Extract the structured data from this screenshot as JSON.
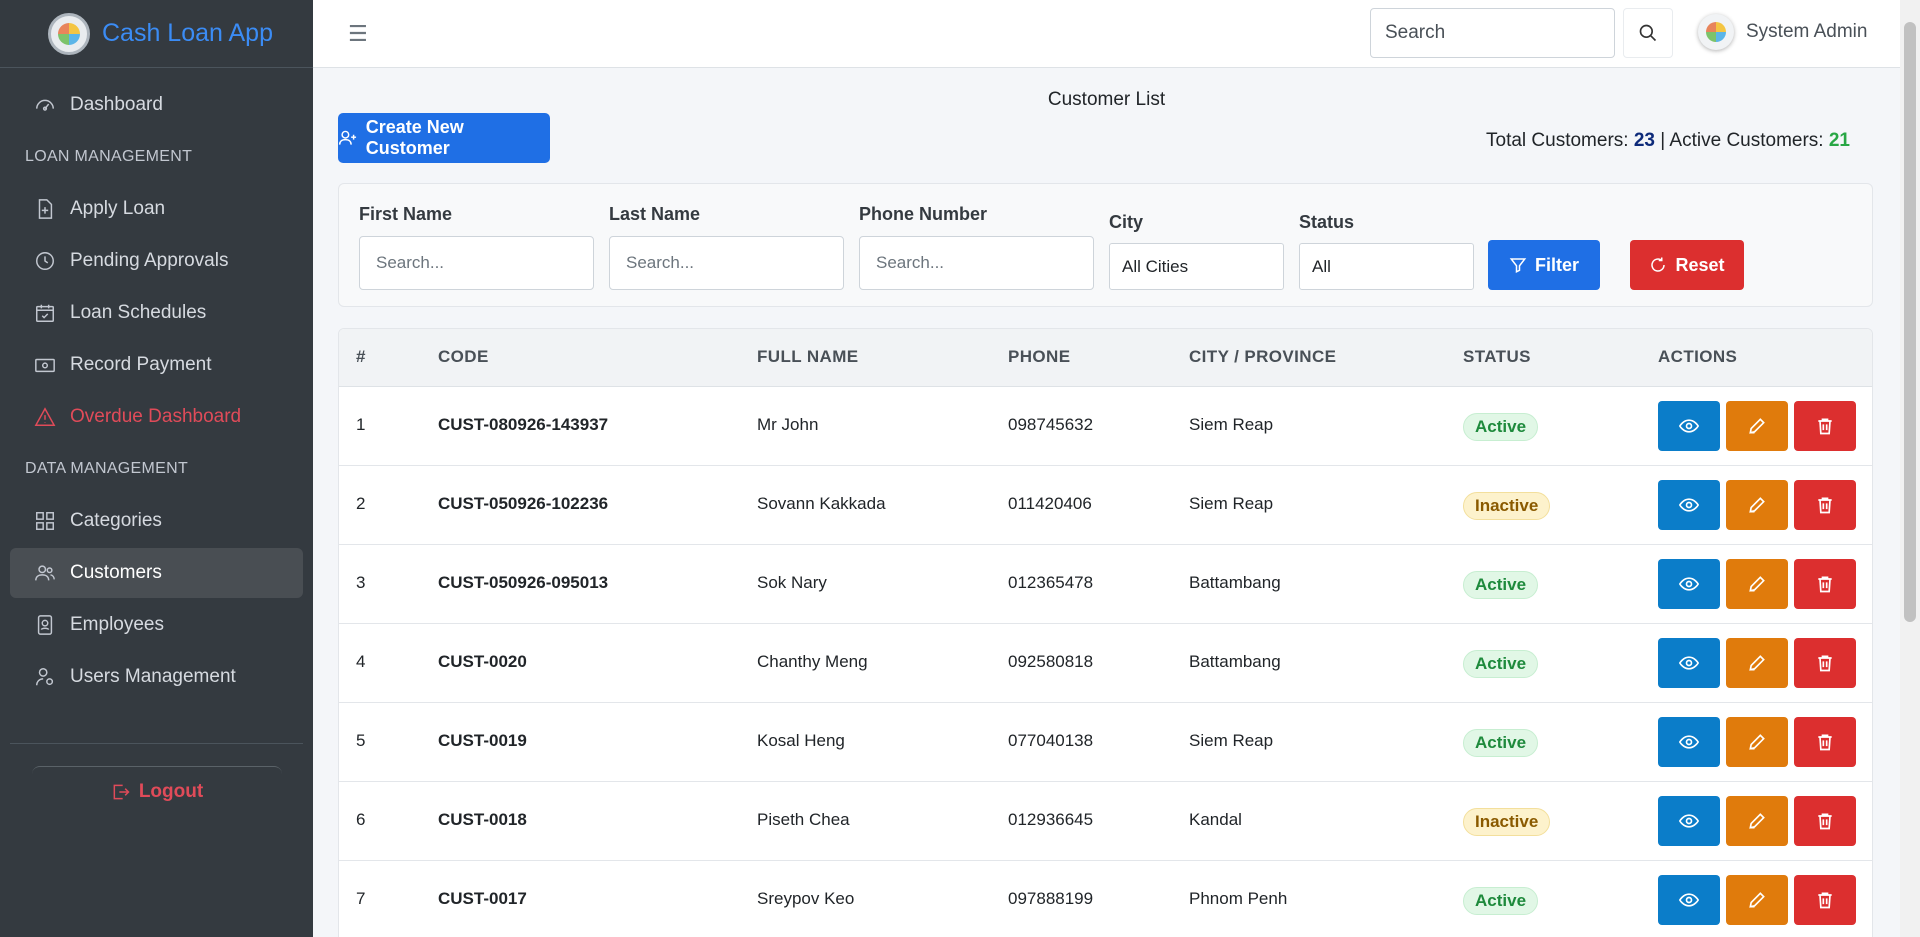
{
  "brand": {
    "name": "Cash Loan App"
  },
  "sidebar": {
    "items": [
      {
        "label": "Dashboard",
        "icon": "gauge-icon"
      },
      {
        "header": "LOAN MANAGEMENT"
      },
      {
        "label": "Apply Loan",
        "icon": "file-plus-icon"
      },
      {
        "label": "Pending Approvals",
        "icon": "clock-icon"
      },
      {
        "label": "Loan Schedules",
        "icon": "calendar-check-icon"
      },
      {
        "label": "Record Payment",
        "icon": "cash-icon"
      },
      {
        "label": "Overdue Dashboard",
        "icon": "warning-icon"
      },
      {
        "header": "DATA MANAGEMENT"
      },
      {
        "label": "Categories",
        "icon": "grid-icon"
      },
      {
        "label": "Customers",
        "icon": "users-icon"
      },
      {
        "label": "Employees",
        "icon": "badge-icon"
      },
      {
        "label": "Users Management",
        "icon": "user-gear-icon"
      }
    ],
    "logout": "Logout"
  },
  "topbar": {
    "search_placeholder": "Search",
    "user_name": "System Admin"
  },
  "page": {
    "title": "Customer List",
    "create_label": "Create New Customer",
    "totals": {
      "total_label": "Total Customers:",
      "total": "23",
      "sep": "|",
      "active_label": "Active Customers:",
      "active": "21"
    }
  },
  "filters": {
    "first_name_label": "First Name",
    "first_name_placeholder": "Search...",
    "last_name_label": "Last Name",
    "last_name_placeholder": "Search...",
    "phone_label": "Phone Number",
    "phone_placeholder": "Search...",
    "city_label": "City",
    "city_value": "All Cities",
    "status_label": "Status",
    "status_value": "All",
    "filter_label": "Filter",
    "reset_label": "Reset"
  },
  "table": {
    "headers": [
      "#",
      "CODE",
      "FULL NAME",
      "PHONE",
      "CITY / PROVINCE",
      "STATUS",
      "ACTIONS"
    ],
    "rows": [
      {
        "n": "1",
        "code": "CUST-080926-143937",
        "name": "Mr John",
        "phone": "098745632",
        "city": "Siem Reap",
        "status": "Active"
      },
      {
        "n": "2",
        "code": "CUST-050926-102236",
        "name": "Sovann Kakkada",
        "phone": "011420406",
        "city": "Siem Reap",
        "status": "Inactive"
      },
      {
        "n": "3",
        "code": "CUST-050926-095013",
        "name": "Sok Nary",
        "phone": "012365478",
        "city": "Battambang",
        "status": "Active"
      },
      {
        "n": "4",
        "code": "CUST-0020",
        "name": "Chanthy Meng",
        "phone": "092580818",
        "city": "Battambang",
        "status": "Active"
      },
      {
        "n": "5",
        "code": "CUST-0019",
        "name": "Kosal Heng",
        "phone": "077040138",
        "city": "Siem Reap",
        "status": "Active"
      },
      {
        "n": "6",
        "code": "CUST-0018",
        "name": "Piseth Chea",
        "phone": "012936645",
        "city": "Kandal",
        "status": "Inactive"
      },
      {
        "n": "7",
        "code": "CUST-0017",
        "name": "Sreypov Keo",
        "phone": "097888199",
        "city": "Phnom Penh",
        "status": "Active"
      }
    ]
  },
  "colors": {
    "brand": "#3b8cf5",
    "primary": "#1f6fe5",
    "danger": "#dc2f2f",
    "warning": "#e07b0c",
    "info": "#0b7dc9",
    "success": "#28a745"
  }
}
